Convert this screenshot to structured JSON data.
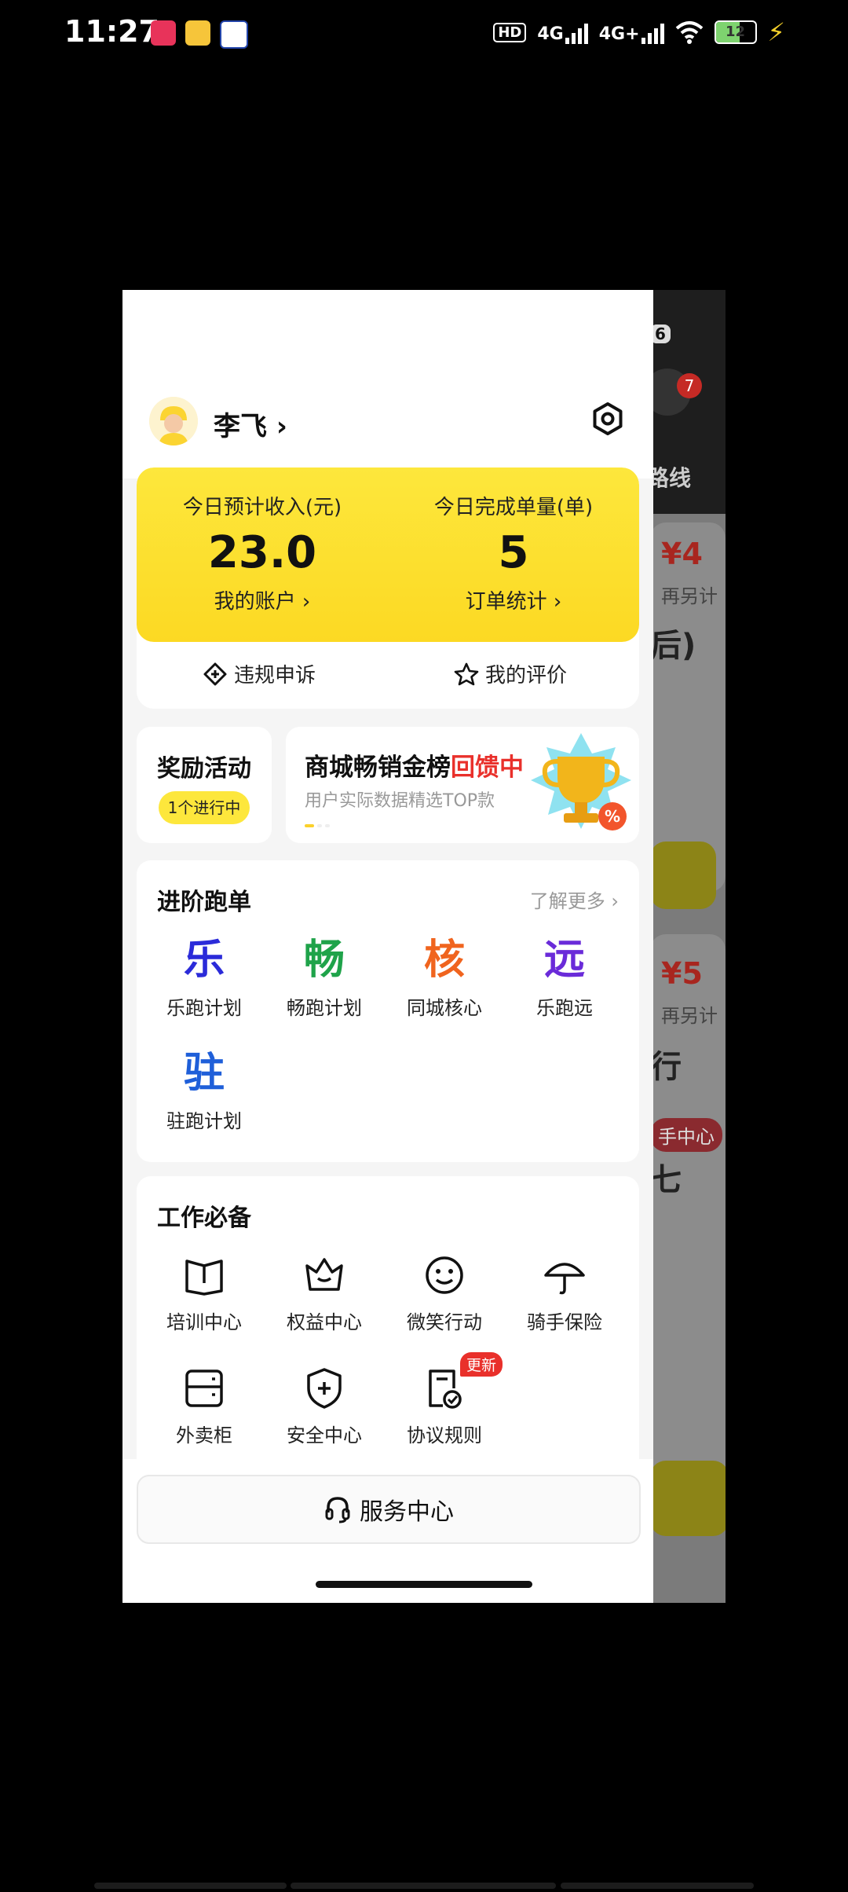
{
  "status_bar": {
    "time": "11:27",
    "network_1": "4G",
    "network_2": "4G+",
    "hd_label": "HD",
    "battery": "12"
  },
  "background": {
    "badge_count": "7",
    "route_label": "路线",
    "price1": "¥4",
    "price2": "¥5",
    "frag1": "再另计",
    "frag2": "再另计",
    "frag3": "后)",
    "frag4": "行",
    "frag5": "手中心",
    "frag6": "七",
    "frag7": "6"
  },
  "profile": {
    "name": "李飞",
    "chevron": "›"
  },
  "stats": {
    "income_label": "今日预计收入(元)",
    "income_value": "23.0",
    "income_link": "我的账户 ›",
    "orders_label": "今日完成单量(单)",
    "orders_value": "5",
    "orders_link": "订单统计 ›",
    "appeal": "违规申诉",
    "rating": "我的评价"
  },
  "reward": {
    "title": "奖励活动",
    "pill": "1个进行中"
  },
  "banner": {
    "title_main": "商城畅销金榜",
    "title_red": "回馈中",
    "subtitle": "用户实际数据精选TOP款"
  },
  "advanced": {
    "title": "进阶跑单",
    "more": "了解更多 ›",
    "items": [
      {
        "glyph": "乐",
        "label": "乐跑计划",
        "color": "#2b2bd9"
      },
      {
        "glyph": "畅",
        "label": "畅跑计划",
        "color": "#1fa34a"
      },
      {
        "glyph": "核",
        "label": "同城核心",
        "color": "#f0641e"
      },
      {
        "glyph": "远",
        "label": "乐跑远",
        "color": "#6a2bd9"
      },
      {
        "glyph": "驻",
        "label": "驻跑计划",
        "color": "#1f5fd9"
      }
    ]
  },
  "work": {
    "title": "工作必备",
    "items": [
      {
        "icon": "book-icon",
        "label": "培训中心"
      },
      {
        "icon": "crown-icon",
        "label": "权益中心"
      },
      {
        "icon": "smile-icon",
        "label": "微笑行动"
      },
      {
        "icon": "umbrella-icon",
        "label": "骑手保险"
      },
      {
        "icon": "locker-icon",
        "label": "外卖柜"
      },
      {
        "icon": "shield-plus-icon",
        "label": "安全中心"
      },
      {
        "icon": "document-check-icon",
        "label": "协议规则",
        "badge": "更新"
      }
    ]
  },
  "service": {
    "label": "服务中心"
  }
}
